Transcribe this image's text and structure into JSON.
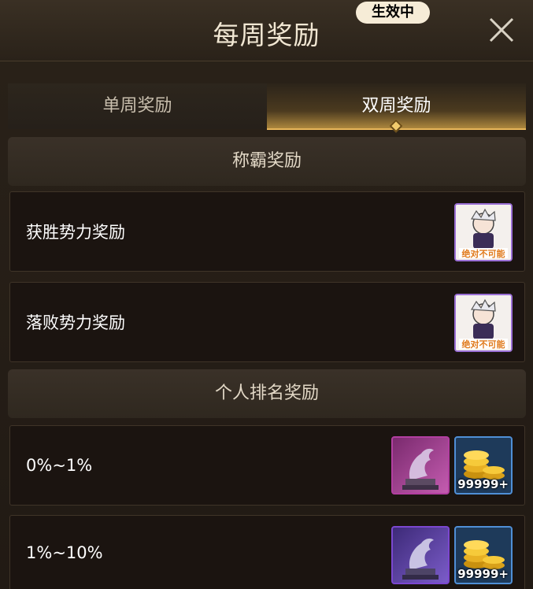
{
  "header": {
    "title": "每周奖励"
  },
  "tabs": [
    {
      "label": "单周奖励",
      "active": false
    },
    {
      "label": "双周奖励",
      "active": true,
      "badge": "生效中"
    }
  ],
  "sections": [
    {
      "title": "称霸奖励"
    },
    {
      "title": "个人排名奖励"
    }
  ],
  "dominance_rows": [
    {
      "label": "获胜势力奖励",
      "rewards": [
        {
          "icon": "character-portrait-icon",
          "text": "绝对不可能"
        }
      ]
    },
    {
      "label": "落败势力奖励",
      "rewards": [
        {
          "icon": "character-portrait-icon",
          "text": "绝对不可能"
        }
      ]
    }
  ],
  "rank_rows": [
    {
      "label": "0%~1%",
      "rewards": [
        {
          "icon": "dragon-statue-icon",
          "frame_color": "#b23fa1"
        },
        {
          "icon": "gold-coins-icon",
          "quantity": "99999+",
          "frame_color": "#4f8fd6"
        }
      ]
    },
    {
      "label": "1%~10%",
      "rewards": [
        {
          "icon": "dragon-statue-icon",
          "frame_color": "#7b47d0"
        },
        {
          "icon": "gold-coins-icon",
          "quantity": "99999+",
          "frame_color": "#4f8fd6"
        }
      ]
    }
  ],
  "colors": {
    "accent": "#e7b65a",
    "tab_active_text": "#ffffff",
    "tab_inactive_text": "#c9bfae"
  }
}
